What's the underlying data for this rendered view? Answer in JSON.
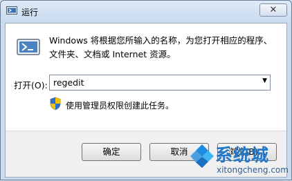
{
  "window": {
    "title": "运行",
    "close_glyph": "✕"
  },
  "dialog": {
    "description": "Windows 将根据您所输入的名称，为您打开相应的程序、文件夹、文档或 Internet 资源。",
    "open_label": "打开(O):",
    "input_value": "regedit",
    "admin_note": "使用管理员权限创建此任务。"
  },
  "buttons": {
    "ok": "确定",
    "cancel": "取消",
    "browse": "浏览(B)..."
  },
  "watermark": {
    "brand": "系统城",
    "url": "xitongcheng.com"
  },
  "icons": {
    "app": "run-app-icon",
    "run": "run-program-icon",
    "shield": "uac-shield-icon",
    "dropdown": "chevron-down-icon"
  }
}
